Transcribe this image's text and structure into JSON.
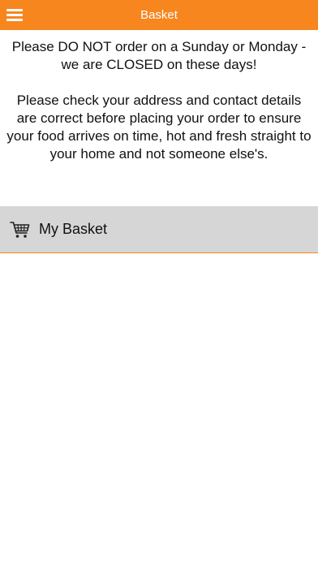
{
  "header": {
    "title": "Basket",
    "menu_icon": "hamburger-menu-icon",
    "background_color": "#f7861f"
  },
  "notice": {
    "paragraph_1": "Please DO NOT order on a Sunday or Monday - we are CLOSED on these days!",
    "paragraph_2": "Please check your address and contact details are correct before placing your order to ensure your food arrives on time, hot and fresh straight to your home and not someone else's."
  },
  "basket_section": {
    "icon": "shopping-cart-icon",
    "label": "My Basket",
    "background_color": "#d6d6d6",
    "accent_color": "#f7861f"
  }
}
